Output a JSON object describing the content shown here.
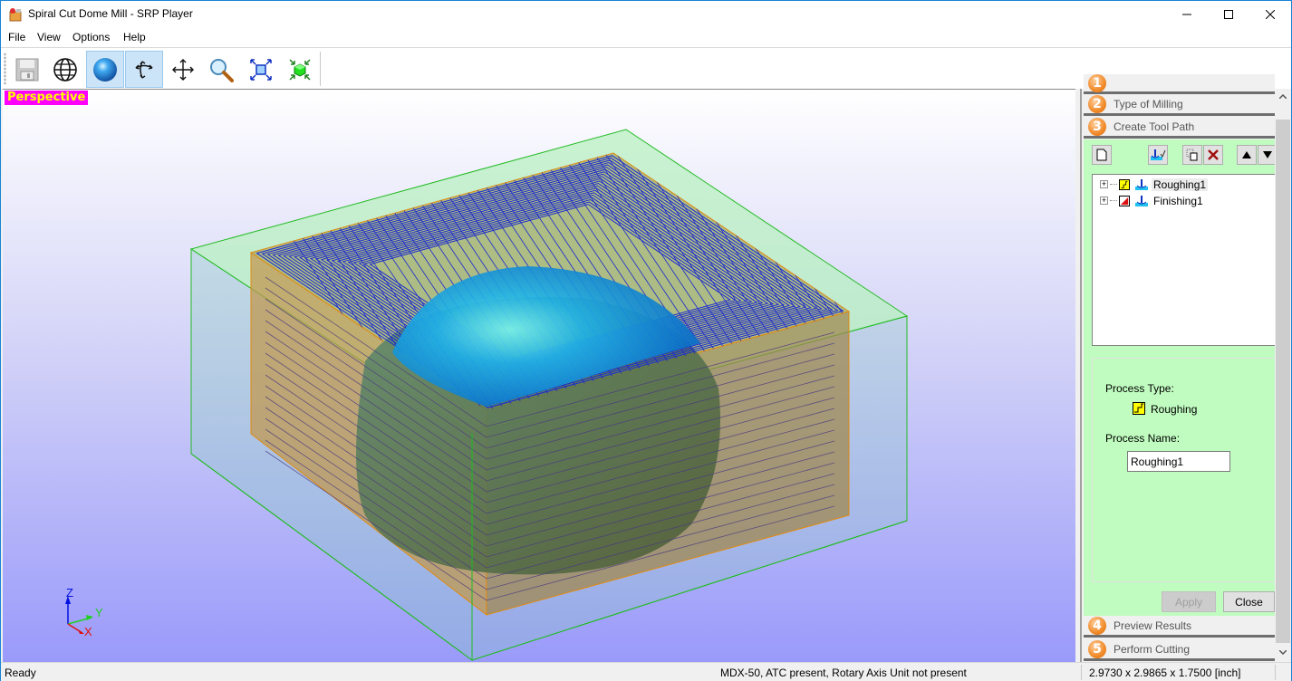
{
  "window": {
    "title": "Spiral Cut Dome Mill - SRP Player",
    "controls": {
      "minimize": "minimize",
      "maximize": "maximize",
      "close": "close"
    }
  },
  "menu": {
    "items": [
      {
        "label": "File"
      },
      {
        "label": "View"
      },
      {
        "label": "Options"
      },
      {
        "label": "Help"
      }
    ]
  },
  "toolbar": {
    "buttons": [
      {
        "icon": "save-icon",
        "active": false
      },
      {
        "icon": "globe-icon",
        "active": false
      },
      {
        "icon": "sphere-render-icon",
        "active": true
      },
      {
        "icon": "rotate-icon",
        "active": true
      },
      {
        "icon": "pan-icon",
        "active": false
      },
      {
        "icon": "zoom-icon",
        "active": false
      },
      {
        "icon": "fit-view-icon",
        "active": false
      },
      {
        "icon": "fit-model-icon",
        "active": false
      }
    ]
  },
  "viewport": {
    "view_mode_label": "Perspective",
    "axes": {
      "z": "Z",
      "y": "Y",
      "x": "X"
    },
    "colors": {
      "stock_box": "#22bb22",
      "workpiece": "#e08a10",
      "toolpath": "#1a28d0",
      "dome": "#1aa8e8",
      "label_bg": "#ff00ff",
      "label_fg": "#ffff00"
    }
  },
  "panel": {
    "steps": [
      {
        "num": "1",
        "label": ""
      },
      {
        "num": "2",
        "label": "Type of Milling"
      },
      {
        "num": "3",
        "label": "Create Tool Path"
      },
      {
        "num": "4",
        "label": "Preview Results"
      },
      {
        "num": "5",
        "label": "Perform Cutting"
      }
    ],
    "step_toolbar": [
      {
        "icon": "new-process-icon"
      },
      {
        "icon": "calculate-toolpath-icon"
      },
      {
        "icon": "copy-icon"
      },
      {
        "icon": "delete-icon"
      },
      {
        "icon": "move-up-icon"
      },
      {
        "icon": "move-down-icon"
      }
    ],
    "processes": [
      {
        "name": "Roughing1",
        "type": "roughing",
        "selected": true
      },
      {
        "name": "Finishing1",
        "type": "finishing",
        "selected": false
      }
    ],
    "process_type_label": "Process Type:",
    "process_type_value": "Roughing",
    "process_name_label": "Process Name:",
    "process_name_value": "Roughing1",
    "apply_label": "Apply",
    "close_label": "Close"
  },
  "status": {
    "left": "Ready",
    "machine": "MDX-50, ATC present, Rotary Axis Unit not present",
    "dimensions": "2.9730 x 2.9865 x 1.7500 [inch]"
  }
}
